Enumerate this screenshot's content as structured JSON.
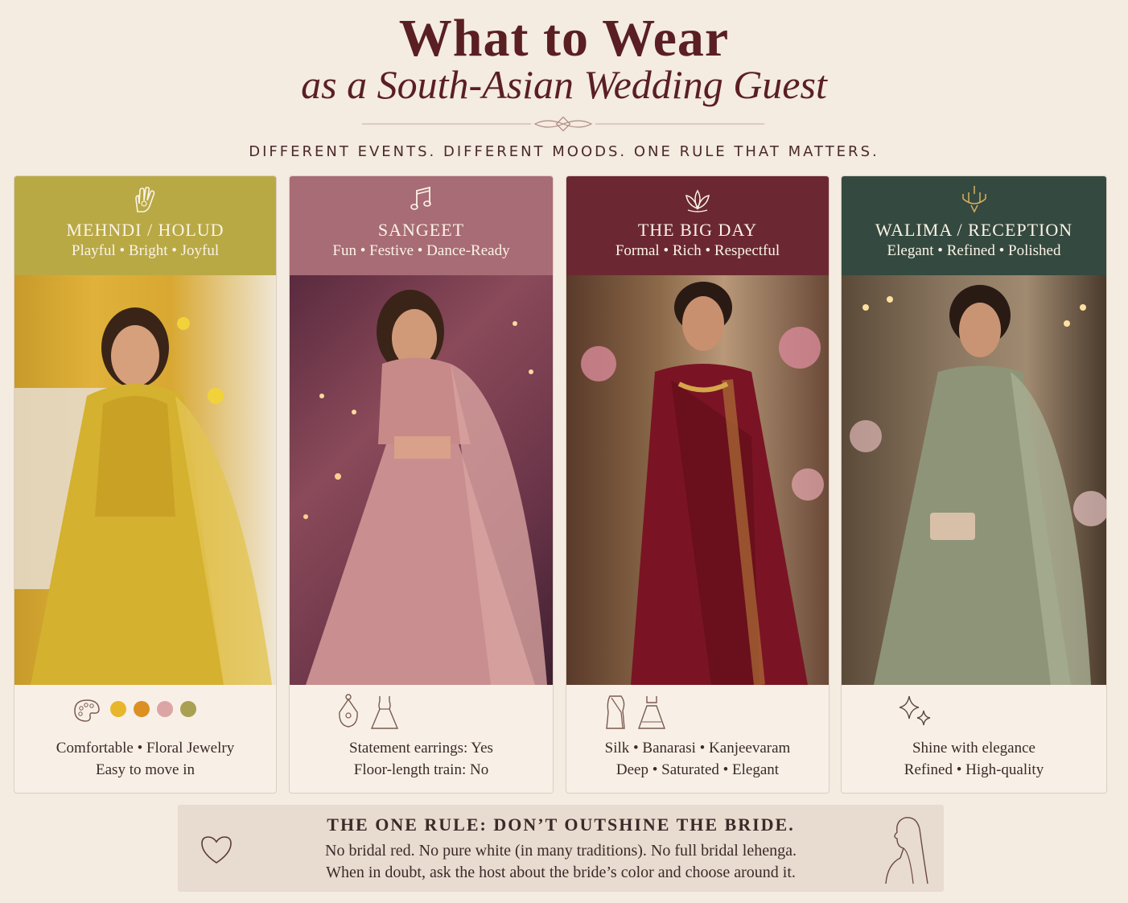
{
  "header": {
    "title": "What to Wear",
    "subtitle": "as a South-Asian Wedding Guest",
    "tagline": "DIFFERENT EVENTS. DIFFERENT MOODS. ONE RULE THAT MATTERS."
  },
  "cards": [
    {
      "title": "MEHNDI / HOLUD",
      "moods": "Playful • Bright • Joyful",
      "icon": "henna-hand-icon",
      "head_color": "#b8a945",
      "line1": "Comfortable • Floral Jewelry",
      "line2": "Easy to move in",
      "swatches": [
        "#e8b62c",
        "#dc8f22",
        "#dca5a5",
        "#a9a052"
      ]
    },
    {
      "title": "SANGEET",
      "moods": "Fun • Festive • Dance-Ready",
      "icon": "music-note-icon",
      "head_color": "#a86c76",
      "line1": "Statement earrings: Yes",
      "line2": "Floor-length train: No"
    },
    {
      "title": "THE BIG DAY",
      "moods": "Formal • Rich • Respectful",
      "icon": "lotus-icon",
      "head_color": "#6b2832",
      "line1": "Silk • Banarasi • Kanjeevaram",
      "line2": "Deep • Saturated • Elegant"
    },
    {
      "title": "WALIMA / RECEPTION",
      "moods": "Elegant • Refined • Polished",
      "icon": "chandelier-icon",
      "head_color": "#34493f",
      "line1": "Shine with elegance",
      "line2": "Refined • High-quality"
    }
  ],
  "rule": {
    "title": "THE ONE RULE: DON’T OUTSHINE THE BRIDE.",
    "line1": "No bridal red. No pure white (in many traditions). No full bridal lehenga.",
    "line2": "When in doubt, ask the host about the bride’s color and choose around it."
  }
}
